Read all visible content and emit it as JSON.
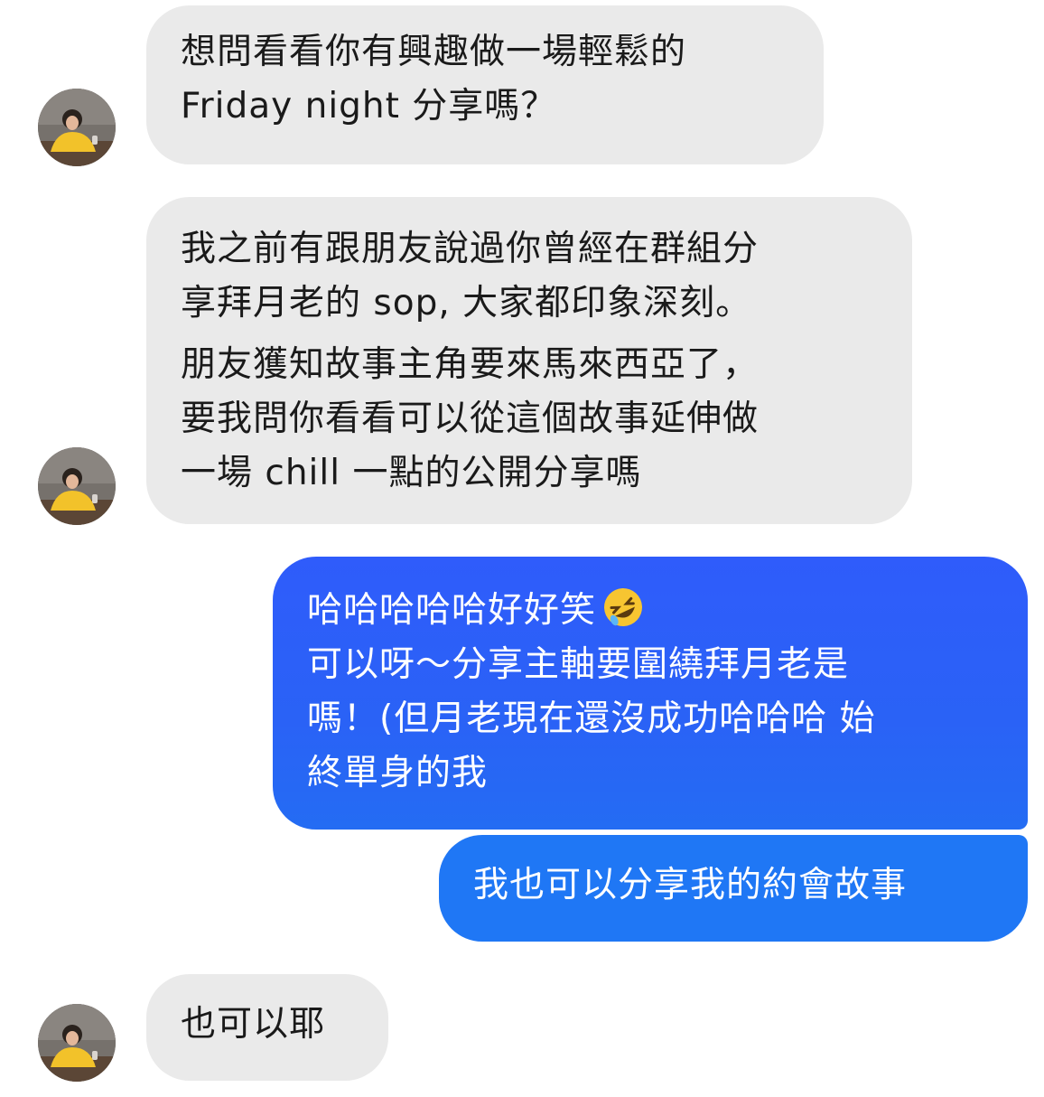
{
  "conversation": {
    "messages": [
      {
        "sender": "them",
        "lines": "想問看看你有興趣做一場輕鬆的\nFriday night 分享嗎？"
      },
      {
        "sender": "them",
        "paragraph1": "我之前有跟朋友說過你曾經在群組分\n享拜月老的 sop, 大家都印象深刻。",
        "paragraph2": "朋友獲知故事主角要來馬來西亞了，\n要我問你看看可以從這個故事延伸做\n一場 chill 一點的公開分享嗎"
      },
      {
        "sender": "me",
        "line1": "哈哈哈哈哈好好笑",
        "emoji": "rolling-on-floor-laughing-emoji",
        "rest": "可以呀～分享主軸要圍繞拜月老是\n嗎！(但月老現在還沒成功哈哈哈 始\n終單身的我"
      },
      {
        "sender": "me",
        "lines": "我也可以分享我的約會故事"
      },
      {
        "sender": "them",
        "lines": "也可以耶"
      }
    ]
  },
  "colors": {
    "incoming_bubble": "#eaeaea",
    "outgoing_bubble_top": "#2f5cfb",
    "outgoing_bubble_bottom": "#1f77f5",
    "avatar_shirt": "#f2c22a"
  }
}
